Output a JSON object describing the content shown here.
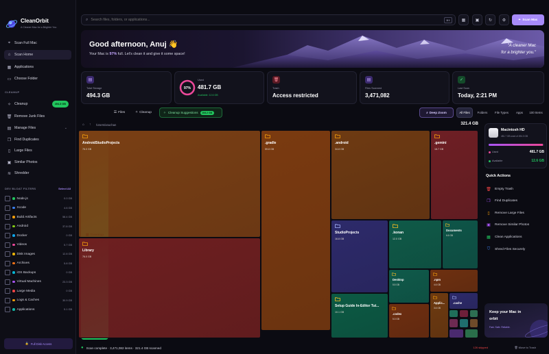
{
  "brand": {
    "name": "CleanOrbit",
    "tagline": "A Cleaner Mac for a Brighter You"
  },
  "nav": [
    {
      "label": "Scan Full Mac",
      "icon": "scan-icon"
    },
    {
      "label": "Scan Home",
      "icon": "home-icon",
      "active": true
    },
    {
      "label": "Applications",
      "icon": "grid-icon"
    },
    {
      "label": "Choose Folder",
      "icon": "folder-icon"
    }
  ],
  "cleanup_section": {
    "heading": "CLEANUP",
    "items": [
      {
        "label": "Cleanup",
        "badge": "494.3 GB",
        "icon": "sparkle-icon"
      },
      {
        "label": "Remove Junk Files",
        "icon": "trash-icon"
      },
      {
        "label": "Manage Files",
        "icon": "files-icon"
      },
      {
        "label": "Find Duplicates",
        "icon": "duplicate-icon"
      },
      {
        "label": "Large Files",
        "icon": "large-file-icon"
      },
      {
        "label": "Similar Photos",
        "icon": "photo-icon"
      },
      {
        "label": "Shredder",
        "icon": "shredder-icon"
      }
    ]
  },
  "bloat_filters": {
    "heading": "DEV BLOAT FILTERS",
    "select_all": "Select All",
    "items": [
      {
        "label": "Node.js",
        "size": "0.0 GB",
        "color": "#22c55e"
      },
      {
        "label": "Xcode",
        "size": "4.6 GB",
        "color": "#3b82f6"
      },
      {
        "label": "Build Artifacts",
        "size": "58.4 GB",
        "color": "#f59e0b"
      },
      {
        "label": "Android",
        "size": "37.8 GB",
        "color": "#84cc16"
      },
      {
        "label": "Docker",
        "size": "0 GB",
        "color": "#0ea5e9"
      },
      {
        "label": "Videos",
        "size": "5.7 GB",
        "color": "#ec4899"
      },
      {
        "label": "Disk Images",
        "size": "12.8 GB",
        "color": "#eab308"
      },
      {
        "label": "Archives",
        "size": "5.8 GB",
        "color": "#f97316"
      },
      {
        "label": "iOS Backups",
        "size": "0 GB",
        "color": "#06b6d4"
      },
      {
        "label": "Virtual Machines",
        "size": "23.3 GB",
        "color": "#a855f7"
      },
      {
        "label": "Large Media",
        "size": "0 GB",
        "color": "#ef4444"
      },
      {
        "label": "Logs & Caches",
        "size": "30.9 GB",
        "color": "#f59e0b"
      },
      {
        "label": "Applications",
        "size": "5.1 GB",
        "color": "#14b8a6"
      }
    ]
  },
  "full_disk_access": "Full Disk Access",
  "search": {
    "placeholder": "Search files, folders, or applications...",
    "shortcut": "⌘K"
  },
  "scan_mac": "Scan Mac",
  "hero": {
    "greeting": "Good afternoon, Anuj 👋",
    "sub_prefix": "Your Mac is ",
    "sub_pct": "97%",
    "sub_suffix": " full. Let's clean it and give it some space!",
    "quote_line1": "\"A cleaner Mac",
    "quote_line2": "for a brighter you.\""
  },
  "stats": {
    "total_storage": {
      "label": "Total Storage",
      "value": "494.3 GB"
    },
    "used": {
      "label": "Used",
      "value": "481.7 GB",
      "available": "Available: 12.6 GB",
      "pct_label": "97%",
      "fraction": 0.97
    },
    "trash": {
      "label": "Trash",
      "value": "Access restricted"
    },
    "files_scanned": {
      "label": "Files Scanned",
      "value": "3,471,082"
    },
    "last_scan": {
      "label": "Last Scan",
      "value": "Today, 2:21 PM"
    }
  },
  "views": {
    "treemap": "Treemap",
    "files": "Files",
    "cleanup": "Cleanup",
    "suggestions": "Cleanup Suggestions",
    "suggestions_badge": "206.2 GB",
    "deep_zoom": "Deep Zoom"
  },
  "filters": [
    "All Files",
    "Folders",
    "File Types",
    "Apps",
    "100 Items"
  ],
  "breadcrumb": {
    "path": "/Users/anuchan",
    "total": "321.4 GB"
  },
  "tiles": [
    {
      "name": "AndroidStudioProjects",
      "size": "76.0 GB",
      "color": "#7a3f14"
    },
    {
      "name": ".gradle",
      "size": "59.8 GB",
      "color": "#7a3a10"
    },
    {
      "name": ".android",
      "size": "34.8 GB",
      "color": "#6e3a12"
    },
    {
      "name": ".gemini",
      "size": "18.7 GB",
      "color": "#6e1f24"
    },
    {
      "name": "Library",
      "size": "76.0 GB",
      "color": "#6e1f20"
    },
    {
      "name": "StudioProjects",
      "size": "16.8 GB",
      "color": "#2d2a6a"
    },
    {
      "name": ".konan",
      "size": "12.0 GB",
      "color": "#0f5a48"
    },
    {
      "name": "Documents",
      "size": "6.6 GB",
      "color": "#0e5548"
    },
    {
      "name": "Desktop",
      "size": "5.5 GB",
      "color": "#0f5a4a"
    },
    {
      "name": ".npm",
      "size": "4.6 GB",
      "color": "#6e3010"
    },
    {
      "name": "Setup Guide In-Editor Tut...",
      "size": "10.1 GB",
      "color": "#0c5a44"
    },
    {
      "name": ".codex",
      "size": "5.3 GB",
      "color": "#6e2e10"
    },
    {
      "name": "Applic...",
      "size": "3.6 GB",
      "color": "#6e3a10"
    },
    {
      "name": ".cache",
      "size": "",
      "color": "#2d2a6a"
    }
  ],
  "status": {
    "text": "Scan complete · 3,471,082 items · 321.4 GB scanned",
    "skipped": "126 skipped",
    "move": "Move to Trash"
  },
  "disk": {
    "name": "Macintosh HD",
    "sub": "481.7 GB used of 494.3 GB",
    "used_label": "Used",
    "used_value": "481.7 GB",
    "available_label": "Available",
    "available_value": "12.6 GB",
    "fraction": 0.97
  },
  "quick_actions": {
    "heading": "Quick Actions",
    "items": [
      {
        "label": "Empty Trash",
        "color": "#ef4444",
        "icon": "trash-icon"
      },
      {
        "label": "Find Duplicates",
        "color": "#a855f7",
        "icon": "duplicate-icon"
      },
      {
        "label": "Remove Large Files",
        "color": "#f59e0b",
        "icon": "large-file-icon"
      },
      {
        "label": "Remove Similar Photos",
        "color": "#a855f7",
        "icon": "photo-icon"
      },
      {
        "label": "Clean Applications",
        "color": "#22c55e",
        "icon": "app-icon"
      },
      {
        "label": "Shred Files Securely",
        "color": "#3b82f6",
        "icon": "shield-icon"
      }
    ]
  },
  "promo": {
    "title": "Keep your Mac in orbit",
    "sub": "Fast. Safe. Reliable."
  }
}
